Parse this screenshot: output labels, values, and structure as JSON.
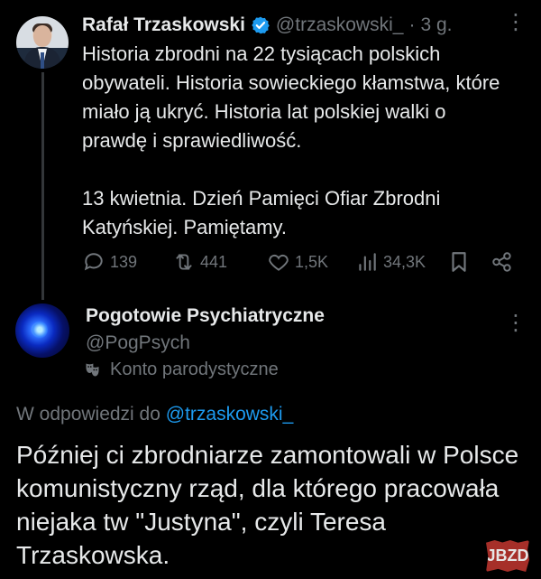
{
  "tweet": {
    "author_name": "Rafał Trzaskowski",
    "handle": "@trzaskowski_",
    "separator": "·",
    "time": "3 g.",
    "text": "Historia zbrodni na 22 tysiącach polskich obywateli. Historia sowieckiego kłamstwa, które miało ją ukryć. Historia lat polskiej walki o prawdę i sprawiedliwość.\n\n13 kwietnia. Dzień Pamięci Ofiar Zbrodni Katyńskiej. Pamiętamy.",
    "actions": {
      "replies": "139",
      "reposts": "441",
      "likes": "1,5K",
      "views": "34,3K"
    }
  },
  "reply": {
    "author_name": "Pogotowie Psychiatryczne",
    "handle": "@PogPsych",
    "account_label": "Konto parodystyczne",
    "reply_prefix": "W odpowiedzi do",
    "reply_handle": "@trzaskowski_",
    "text": "Później ci zbrodniarze zamontowali w Polsce komunistyczny rząd, dla którego pracowała niejaka tw \"Justyna\", czyli Teresa Trzaskowska."
  },
  "watermark": {
    "label": "JBZD"
  },
  "colors": {
    "background": "#000000",
    "text": "#e7e9ea",
    "muted": "#71767b",
    "link": "#1d9bf0",
    "verified": "#1d9bf0"
  }
}
